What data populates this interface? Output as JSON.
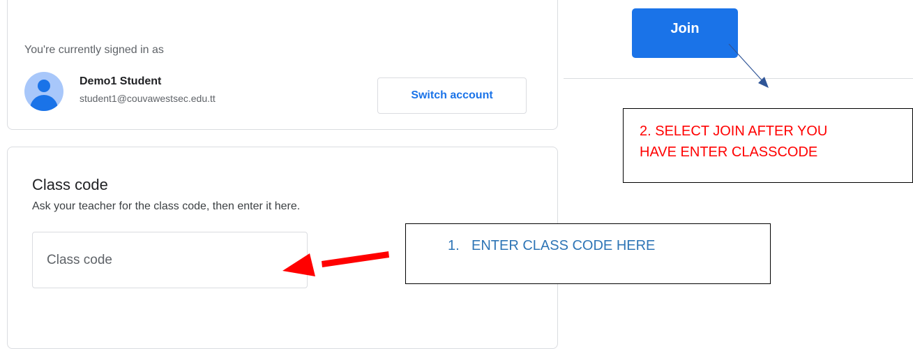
{
  "account": {
    "signed_in_label": "You're currently signed in as",
    "user_name": "Demo1 Student",
    "user_email": "student1@couvawestsec.edu.tt",
    "switch_button_label": "Switch account"
  },
  "class_code": {
    "title": "Class code",
    "help_text": "Ask your teacher for the class code, then enter it here.",
    "input_placeholder": "Class code",
    "input_value": ""
  },
  "join_button_label": "Join",
  "annotations": {
    "step_join": {
      "line1": "2. SELECT JOIN AFTER YOU",
      "line2": "HAVE ENTER CLASSCODE"
    },
    "step_code": {
      "number": "1.",
      "text": "ENTER CLASS CODE HERE"
    }
  },
  "colors": {
    "accent": "#1a73e8",
    "annotation_red": "#ff0000",
    "annotation_blue": "#2e75b6",
    "border": "#dadce0"
  }
}
